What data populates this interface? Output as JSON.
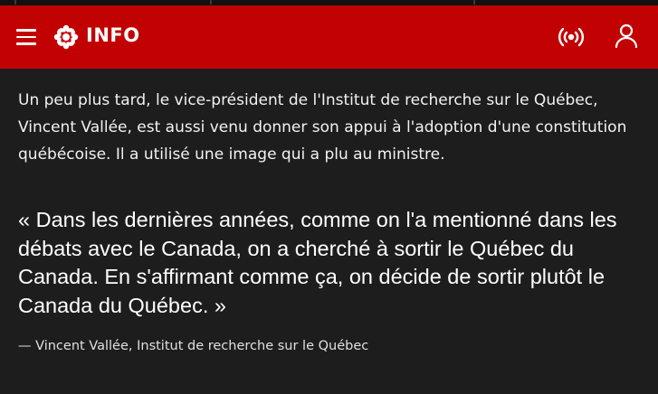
{
  "header": {
    "brand": "INFO",
    "icons": {
      "menu": "hamburger-menu-icon",
      "logo": "cbc-gem-logo-icon",
      "live": "live-broadcast-icon",
      "account": "user-account-icon"
    },
    "bg_color": "#c20202"
  },
  "article": {
    "paragraph": "Un peu plus tard, le vice-président de l'Institut de recherche sur le Québec, Vincent Vallée, est aussi venu donner son appui à l'adoption d'une constitution québécoise. Il a utilisé une image qui a plu au ministre.",
    "quote": "« Dans les dernières années, comme on l'a mentionné dans les débats avec le Canada, on a cherché à sortir le Québec du Canada. En s'affirmant comme ça, on décide de sortir plutôt le Canada du Québec. »",
    "attribution": "— Vincent Vallée, Institut de recherche sur le Québec"
  }
}
